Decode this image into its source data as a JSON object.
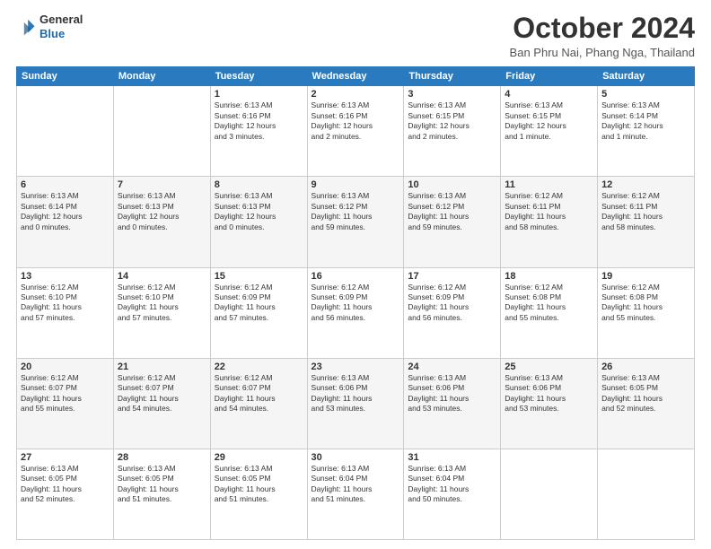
{
  "header": {
    "logo_line1": "General",
    "logo_line2": "Blue",
    "title": "October 2024",
    "location": "Ban Phru Nai, Phang Nga, Thailand"
  },
  "days_of_week": [
    "Sunday",
    "Monday",
    "Tuesday",
    "Wednesday",
    "Thursday",
    "Friday",
    "Saturday"
  ],
  "weeks": [
    [
      {
        "day": "",
        "info": ""
      },
      {
        "day": "",
        "info": ""
      },
      {
        "day": "1",
        "info": "Sunrise: 6:13 AM\nSunset: 6:16 PM\nDaylight: 12 hours\nand 3 minutes."
      },
      {
        "day": "2",
        "info": "Sunrise: 6:13 AM\nSunset: 6:16 PM\nDaylight: 12 hours\nand 2 minutes."
      },
      {
        "day": "3",
        "info": "Sunrise: 6:13 AM\nSunset: 6:15 PM\nDaylight: 12 hours\nand 2 minutes."
      },
      {
        "day": "4",
        "info": "Sunrise: 6:13 AM\nSunset: 6:15 PM\nDaylight: 12 hours\nand 1 minute."
      },
      {
        "day": "5",
        "info": "Sunrise: 6:13 AM\nSunset: 6:14 PM\nDaylight: 12 hours\nand 1 minute."
      }
    ],
    [
      {
        "day": "6",
        "info": "Sunrise: 6:13 AM\nSunset: 6:14 PM\nDaylight: 12 hours\nand 0 minutes."
      },
      {
        "day": "7",
        "info": "Sunrise: 6:13 AM\nSunset: 6:13 PM\nDaylight: 12 hours\nand 0 minutes."
      },
      {
        "day": "8",
        "info": "Sunrise: 6:13 AM\nSunset: 6:13 PM\nDaylight: 12 hours\nand 0 minutes."
      },
      {
        "day": "9",
        "info": "Sunrise: 6:13 AM\nSunset: 6:12 PM\nDaylight: 11 hours\nand 59 minutes."
      },
      {
        "day": "10",
        "info": "Sunrise: 6:13 AM\nSunset: 6:12 PM\nDaylight: 11 hours\nand 59 minutes."
      },
      {
        "day": "11",
        "info": "Sunrise: 6:12 AM\nSunset: 6:11 PM\nDaylight: 11 hours\nand 58 minutes."
      },
      {
        "day": "12",
        "info": "Sunrise: 6:12 AM\nSunset: 6:11 PM\nDaylight: 11 hours\nand 58 minutes."
      }
    ],
    [
      {
        "day": "13",
        "info": "Sunrise: 6:12 AM\nSunset: 6:10 PM\nDaylight: 11 hours\nand 57 minutes."
      },
      {
        "day": "14",
        "info": "Sunrise: 6:12 AM\nSunset: 6:10 PM\nDaylight: 11 hours\nand 57 minutes."
      },
      {
        "day": "15",
        "info": "Sunrise: 6:12 AM\nSunset: 6:09 PM\nDaylight: 11 hours\nand 57 minutes."
      },
      {
        "day": "16",
        "info": "Sunrise: 6:12 AM\nSunset: 6:09 PM\nDaylight: 11 hours\nand 56 minutes."
      },
      {
        "day": "17",
        "info": "Sunrise: 6:12 AM\nSunset: 6:09 PM\nDaylight: 11 hours\nand 56 minutes."
      },
      {
        "day": "18",
        "info": "Sunrise: 6:12 AM\nSunset: 6:08 PM\nDaylight: 11 hours\nand 55 minutes."
      },
      {
        "day": "19",
        "info": "Sunrise: 6:12 AM\nSunset: 6:08 PM\nDaylight: 11 hours\nand 55 minutes."
      }
    ],
    [
      {
        "day": "20",
        "info": "Sunrise: 6:12 AM\nSunset: 6:07 PM\nDaylight: 11 hours\nand 55 minutes."
      },
      {
        "day": "21",
        "info": "Sunrise: 6:12 AM\nSunset: 6:07 PM\nDaylight: 11 hours\nand 54 minutes."
      },
      {
        "day": "22",
        "info": "Sunrise: 6:12 AM\nSunset: 6:07 PM\nDaylight: 11 hours\nand 54 minutes."
      },
      {
        "day": "23",
        "info": "Sunrise: 6:13 AM\nSunset: 6:06 PM\nDaylight: 11 hours\nand 53 minutes."
      },
      {
        "day": "24",
        "info": "Sunrise: 6:13 AM\nSunset: 6:06 PM\nDaylight: 11 hours\nand 53 minutes."
      },
      {
        "day": "25",
        "info": "Sunrise: 6:13 AM\nSunset: 6:06 PM\nDaylight: 11 hours\nand 53 minutes."
      },
      {
        "day": "26",
        "info": "Sunrise: 6:13 AM\nSunset: 6:05 PM\nDaylight: 11 hours\nand 52 minutes."
      }
    ],
    [
      {
        "day": "27",
        "info": "Sunrise: 6:13 AM\nSunset: 6:05 PM\nDaylight: 11 hours\nand 52 minutes."
      },
      {
        "day": "28",
        "info": "Sunrise: 6:13 AM\nSunset: 6:05 PM\nDaylight: 11 hours\nand 51 minutes."
      },
      {
        "day": "29",
        "info": "Sunrise: 6:13 AM\nSunset: 6:05 PM\nDaylight: 11 hours\nand 51 minutes."
      },
      {
        "day": "30",
        "info": "Sunrise: 6:13 AM\nSunset: 6:04 PM\nDaylight: 11 hours\nand 51 minutes."
      },
      {
        "day": "31",
        "info": "Sunrise: 6:13 AM\nSunset: 6:04 PM\nDaylight: 11 hours\nand 50 minutes."
      },
      {
        "day": "",
        "info": ""
      },
      {
        "day": "",
        "info": ""
      }
    ]
  ]
}
